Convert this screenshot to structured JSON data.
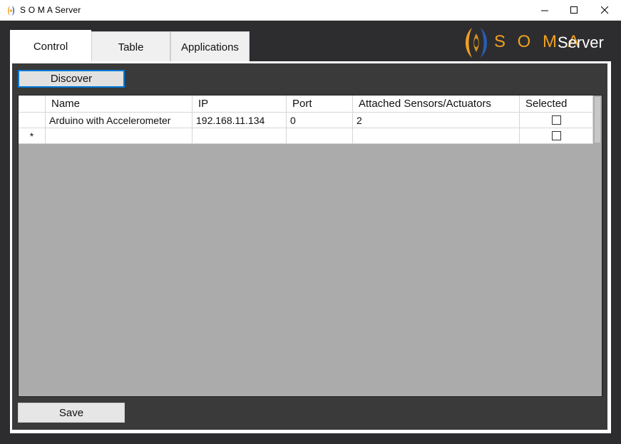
{
  "window": {
    "title": "S O M A Server",
    "controls": {
      "minimize_icon": "minimize-icon",
      "maximize_icon": "maximize-icon",
      "close_icon": "close-icon"
    }
  },
  "tabs": [
    {
      "label": "Control",
      "active": true
    },
    {
      "label": "Table",
      "active": false
    },
    {
      "label": "Applications",
      "active": false
    }
  ],
  "logo": {
    "brand": "S O M A",
    "product": "Server",
    "brand_color": "#f0a020"
  },
  "toolbar": {
    "discover_label": "Discover",
    "save_label": "Save"
  },
  "grid": {
    "columns": [
      "Name",
      "IP",
      "Port",
      "Attached Sensors/Actuators",
      "Selected"
    ],
    "rows": [
      {
        "name": "Arduino with Accelerometer",
        "ip": "192.168.11.134",
        "port": "0",
        "attached": "2",
        "selected": false
      }
    ],
    "new_row_marker": "*",
    "new_row_selected": false
  },
  "colors": {
    "window_bg": "#2d2d30",
    "panel_bg": "#3a3a3a",
    "grid_bg": "#ababab",
    "focus_border": "#0078d7"
  }
}
